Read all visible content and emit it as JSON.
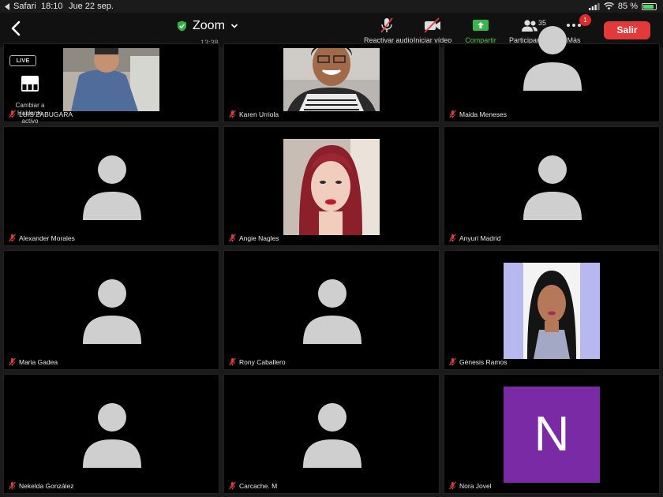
{
  "status": {
    "app": "Safari",
    "time": "18:10",
    "date": "Jue 22 sep.",
    "battery": "85 %",
    "battery_level": 0.85
  },
  "meeting": {
    "title": "Zoom",
    "duration": "13:38"
  },
  "toolbar": {
    "unmute_label": "Reactivar audio",
    "video_label": "Iniciar vídeo",
    "share_label": "Compartir",
    "participants_label": "Participantes",
    "participants_count": "35",
    "more_label": "Más",
    "more_badge": "1",
    "exit_label": "Salir"
  },
  "overlay": {
    "live_label": "LIVE",
    "speaker_label_1": "Cambiar a",
    "speaker_label_2": "Hablante",
    "speaker_label_3": "activo"
  },
  "participants": [
    {
      "name": "LUIS ZABUGARA",
      "kind": "photo"
    },
    {
      "name": "Karen Urriola",
      "kind": "photo"
    },
    {
      "name": "Maida Meneses",
      "kind": "avatar"
    },
    {
      "name": "Alexander Morales",
      "kind": "avatar"
    },
    {
      "name": "Angie Nagles",
      "kind": "photo"
    },
    {
      "name": "Anyuri Madrid",
      "kind": "avatar"
    },
    {
      "name": "Maria Gadea",
      "kind": "avatar"
    },
    {
      "name": "Rony Caballero",
      "kind": "avatar"
    },
    {
      "name": "Génesis Ramos",
      "kind": "photo"
    },
    {
      "name": "Nekelda González",
      "kind": "avatar"
    },
    {
      "name": "Carcache. M",
      "kind": "avatar"
    },
    {
      "name": "Nora Jovel",
      "kind": "initial",
      "initial": "N"
    }
  ],
  "colors": {
    "exit": "#e23a3a",
    "share_green": "#4fc24f",
    "muted_red": "#e03a3a",
    "initial_bg": "#7b2aa6"
  }
}
